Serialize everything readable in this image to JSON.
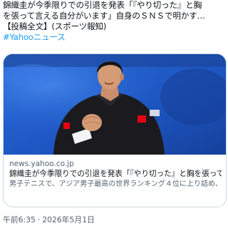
{
  "post": {
    "text_line1": "錦織圭が今季限りでの引退を発表「『やり切った』と胸",
    "text_line2": "を張って言える自分がいます」自身のＳＮＳで明かす…",
    "text_line3": "【投稿全文】(スポーツ報知)",
    "hashtag": "#Yahooニュース"
  },
  "card": {
    "domain": "news.yahoo.co.jp",
    "title": "錦織圭が今季限りでの引退を発表「『やり切った』と胸を張って言え...",
    "description": "男子テニスで、アジア男子最高の世界ランキング４位に上り詰め、２０１４年全米では準優勝に輝いた錦織圭（３６）＝ユニクロ＝が、今...",
    "image_alt": "tennis player clenching fist"
  },
  "footer": {
    "time": "午前6:35",
    "separator": "·",
    "date": "2026年5月1日"
  },
  "colors": {
    "link": "#1d9bf0",
    "background_court": "#1f5bc7",
    "shirt": "#1b1b1f"
  }
}
